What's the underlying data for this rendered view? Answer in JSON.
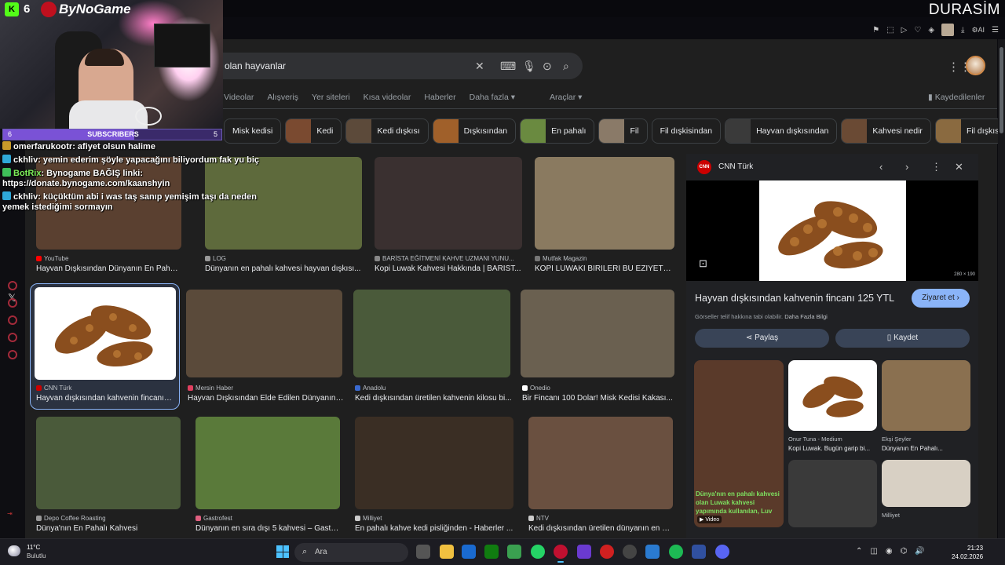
{
  "overlay": {
    "kick_count": "6",
    "brand_name": "ByNoGame",
    "durasim": "DURASİM",
    "subscribers": {
      "left": "6",
      "label": "SUBSCRIBERS",
      "right": "5",
      "progress": 0.6
    },
    "chat": [
      {
        "user": "omerfarukootr",
        "text": ": afiyet olsun halime",
        "badge": "o"
      },
      {
        "user": "ckhliv",
        "text": ": yemin ederim şöyle yapacağını biliyordum fak yu biç",
        "badge": "b"
      },
      {
        "user": "BotRix",
        "text": ": Bynogame BAĞIŞ linki: https://donate.bynogame.com/kaanshyin",
        "badge": "g"
      },
      {
        "user": "ckhliv",
        "text": ": küçüktüm abi i was taş sanıp yemişim taşı da neden yemek istediğimi sormayın",
        "badge": "b"
      }
    ]
  },
  "browser_toolbar": {
    "ai_label": "AI"
  },
  "search": {
    "query": "olan hayvanlar",
    "tabs": [
      "Videolar",
      "Alışveriş",
      "Yer siteleri",
      "Kısa videolar",
      "Haberler",
      "Daha fazla ▾"
    ],
    "tools": "Araçlar ▾",
    "saved": "Kaydedilenler"
  },
  "chips": [
    {
      "label": "Misk kedisi",
      "img": false,
      "color": "#6b5a48"
    },
    {
      "label": "Kedi",
      "img": true,
      "color": "#7a4a30"
    },
    {
      "label": "Kedi dışkısı",
      "img": true,
      "color": "#5c4a3a"
    },
    {
      "label": "Dışkısından",
      "img": true,
      "color": "#a0602a"
    },
    {
      "label": "En pahalı",
      "img": true,
      "color": "#6a8a40"
    },
    {
      "label": "Fil",
      "img": true,
      "color": "#8a7a68"
    },
    {
      "label": "Fil dışkisindan",
      "img": false,
      "color": "#555"
    },
    {
      "label": "Hayvan dışkısından",
      "img": true,
      "color": "#3a3a3a"
    },
    {
      "label": "Kahvesi nedir",
      "img": true,
      "color": "#6a4a34"
    },
    {
      "label": "Fil dışkısı",
      "img": true,
      "color": "#8a6a40"
    }
  ],
  "results": [
    {
      "source": "YouTube",
      "caption": "Hayvan Dışkısından Dünyanın En Pahalı K...",
      "img_color": "#5a4030",
      "src_color": "#ff0000"
    },
    {
      "source": "LOG",
      "caption": "Dünyanın en pahalı kahvesi hayvan dışkısı...",
      "img_color": "#5e6a3c",
      "src_color": "#999"
    },
    {
      "source": "BARİSTA EĞİTMENİ KAHVE UZMANI YUNU...",
      "caption": "Kopi Luwak Kahvesi Hakkında | BARİST...",
      "img_color": "#3a3030",
      "src_color": "#888"
    },
    {
      "source": "Mutfak Magazin",
      "caption": "KOPI LUWAKI BİRİLERİ BU EZİYETE...",
      "img_color": "#8a7a60",
      "src_color": "#777"
    },
    {
      "source": "CNN Türk",
      "caption": "Hayvan dışkısından kahvenin fincanı 1...",
      "img_color": "#ffffff",
      "src_color": "#cc0000"
    },
    {
      "source": "Mersin Haber",
      "caption": "Hayvan Dışkısından Elde Edilen Dünyanın ...",
      "img_color": "#5a4a3a",
      "src_color": "#e04060"
    },
    {
      "source": "Anadolu",
      "caption": "Kedi dışkısından üretilen kahvenin kilosu bi...",
      "img_color": "#4a5a3a",
      "src_color": "#3a6ad0"
    },
    {
      "source": "Onedio",
      "caption": "Bir Fincanı 100 Dolar! Misk Kedisi Kakası...",
      "img_color": "#6a6050",
      "src_color": "#fff"
    },
    {
      "source": "Depo Coffee Roasting",
      "caption": "Dünya'nın En Pahalı Kahvesi",
      "img_color": "#4a5a3a",
      "src_color": "#999"
    },
    {
      "source": "Gastrofest",
      "caption": "Dünyanın en sıra dışı 5 kahvesi – Gastro...",
      "img_color": "#5a7a3a",
      "src_color": "#e06080"
    },
    {
      "source": "Milliyet",
      "caption": "En pahalı kahve kedi pisliğinden - Haberler ...",
      "img_color": "#3a2e24",
      "src_color": "#ccc"
    },
    {
      "source": "NTV",
      "caption": "Kedi dışkısından üretilen dünyanın en pa...",
      "img_color": "#6a5040",
      "src_color": "#ccc"
    }
  ],
  "panel": {
    "source": "CNN Türk",
    "logo_text": "CNN",
    "dimensions": "280 × 190",
    "title": "Hayvan dışkısından kahvenin fincanı 125 YTL",
    "visit": "Ziyaret et ›",
    "copyright": "Görseller telif hakkına tabi olabilir.",
    "copyright_link": "Daha Fazla Bilgi",
    "share": "Paylaş",
    "save": "Kaydet",
    "related": [
      {
        "source": "",
        "caption": "",
        "img_color": "#5a3a2a",
        "overlay": "Dünya'nın en pahalı kahvesi olan Luwak kahvesi yapımında kullanılan, Luv",
        "video": "Video"
      },
      {
        "source": "Onur Tuna - Medium",
        "caption": "Kopi Luwak. Bugün garip bi...",
        "img_color": "#ffffff"
      },
      {
        "source": "Ekşi Şeyler",
        "caption": "Dünyanın En Pahalı...",
        "img_color": "#8a7050"
      },
      {
        "source": "",
        "caption": "",
        "img_color": "#3a3a3a"
      },
      {
        "source": "Milliyet",
        "caption": "",
        "img_color": "#d8d0c4"
      }
    ]
  },
  "taskbar": {
    "temp": "11°C",
    "weather": "Bulutlu",
    "search_placeholder": "Ara",
    "time": "21:23",
    "date": "24.02.2026"
  }
}
